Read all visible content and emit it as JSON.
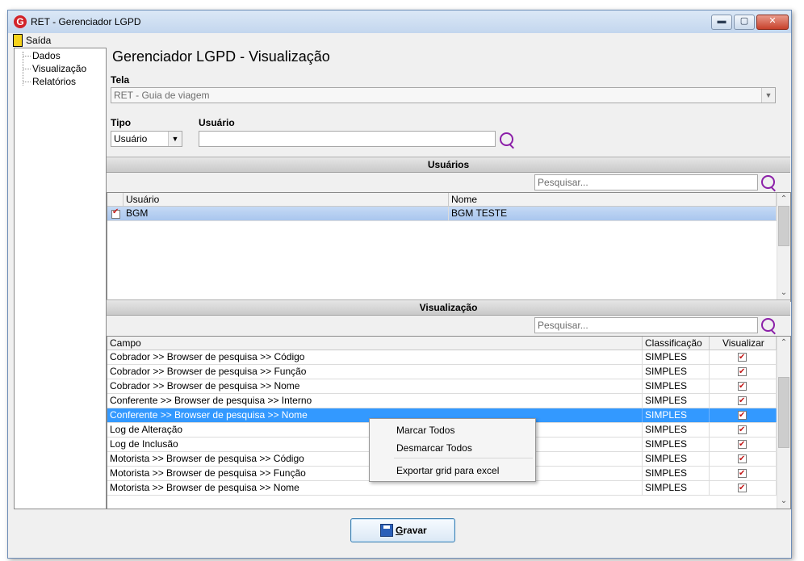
{
  "window": {
    "title": "RET - Gerenciador LGPD",
    "logo_letter": "G"
  },
  "window_controls": {
    "minimize": "▬",
    "maximize": "▢",
    "close": "✕"
  },
  "menu": {
    "items": [
      {
        "label": "Saída"
      }
    ]
  },
  "tree": {
    "items": [
      "Dados",
      "Visualização",
      "Relatórios"
    ]
  },
  "page": {
    "title": "Gerenciador LGPD - Visualização"
  },
  "tela": {
    "label": "Tela",
    "value": "RET - Guia de viagem"
  },
  "tipo": {
    "label": "Tipo",
    "value": "Usuário"
  },
  "usuario": {
    "label": "Usuário",
    "value": ""
  },
  "usuarios_section": {
    "title": "Usuários",
    "search_placeholder": "Pesquisar...",
    "columns": [
      "Usuário",
      "Nome"
    ],
    "rows": [
      {
        "checked": true,
        "usuario": "BGM",
        "nome": "BGM TESTE"
      }
    ]
  },
  "visualizacao_section": {
    "title": "Visualização",
    "search_placeholder": "Pesquisar...",
    "columns": [
      "Campo",
      "Classificação",
      "Visualizar"
    ],
    "rows": [
      {
        "campo": "Cobrador >> Browser de pesquisa >> Código",
        "classificacao": "SIMPLES",
        "visualizar": true
      },
      {
        "campo": "Cobrador >> Browser de pesquisa >> Função",
        "classificacao": "SIMPLES",
        "visualizar": true
      },
      {
        "campo": "Cobrador >> Browser de pesquisa >> Nome",
        "classificacao": "SIMPLES",
        "visualizar": true
      },
      {
        "campo": "Conferente >> Browser de pesquisa >> Interno",
        "classificacao": "SIMPLES",
        "visualizar": true
      },
      {
        "campo": "Conferente >> Browser de pesquisa >> Nome",
        "classificacao": "SIMPLES",
        "visualizar": true,
        "selected": true
      },
      {
        "campo": "Log de Alteração",
        "classificacao": "SIMPLES",
        "visualizar": true
      },
      {
        "campo": "Log de Inclusão",
        "classificacao": "SIMPLES",
        "visualizar": true
      },
      {
        "campo": "Motorista >> Browser de pesquisa >> Código",
        "classificacao": "SIMPLES",
        "visualizar": true
      },
      {
        "campo": "Motorista >> Browser de pesquisa >> Função",
        "classificacao": "SIMPLES",
        "visualizar": true
      },
      {
        "campo": "Motorista >> Browser de pesquisa >> Nome",
        "classificacao": "SIMPLES",
        "visualizar": true
      }
    ]
  },
  "context_menu": {
    "items": [
      "Marcar Todos",
      "Desmarcar Todos",
      "Exportar grid para excel"
    ]
  },
  "actions": {
    "save_hotkey": "G",
    "save_rest": "ravar"
  },
  "scroll_icons": {
    "up": "⌃",
    "down": "⌄",
    "combo_arrow": "▼"
  },
  "colors": {
    "selection": "#3399ff",
    "search_icon": "#8b1fa8",
    "check": "#c41a1a"
  }
}
